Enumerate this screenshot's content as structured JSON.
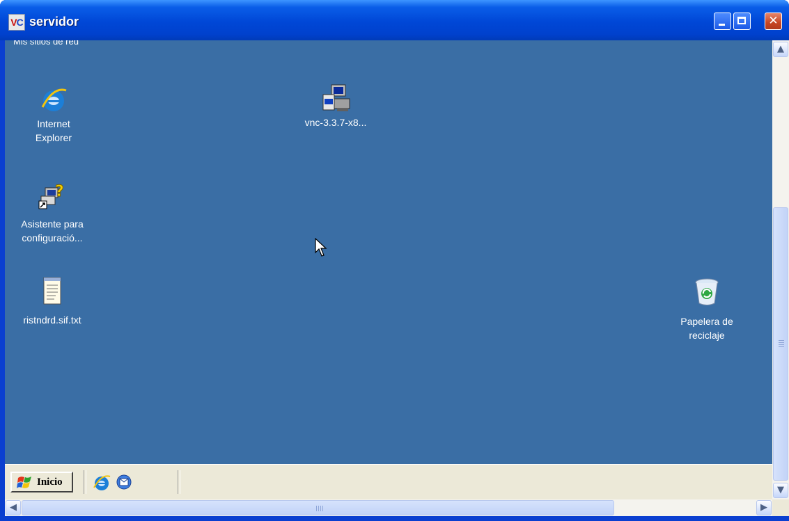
{
  "window": {
    "title": "servidor",
    "app_icon_text": "VC"
  },
  "title_buttons": {
    "minimize_icon": "minimize-icon",
    "maximize_icon": "maximize-icon",
    "close_icon": "close-icon"
  },
  "desktop": {
    "background": "#3a6ea5",
    "top_cut_label": "Mis sitios de red",
    "icons": [
      {
        "id": "internet-explorer",
        "label_line1": "Internet",
        "label_line2": "Explorer",
        "icon": "internet-explorer-icon"
      },
      {
        "id": "vnc-installer",
        "label_line1": "vnc-3.3.7-x8...",
        "icon": "installer-icon"
      },
      {
        "id": "setup-wizard",
        "label_line1": "Asistente para",
        "label_line2": "configuració...",
        "icon": "wizard-shortcut-icon"
      },
      {
        "id": "text-file",
        "label_line1": "ristndrd.sif.txt",
        "icon": "notepad-file-icon"
      },
      {
        "id": "recycle-bin",
        "label_line1": "Papelera de",
        "label_line2": "reciclaje",
        "icon": "recycle-bin-icon"
      }
    ]
  },
  "taskbar": {
    "start_label": "Inicio",
    "quick_launch": [
      "internet-explorer-icon",
      "outlook-express-icon"
    ]
  },
  "scrollbars": {
    "up_arrow": "▲",
    "down_arrow": "▼",
    "left_arrow": "◀",
    "right_arrow": "▶"
  }
}
